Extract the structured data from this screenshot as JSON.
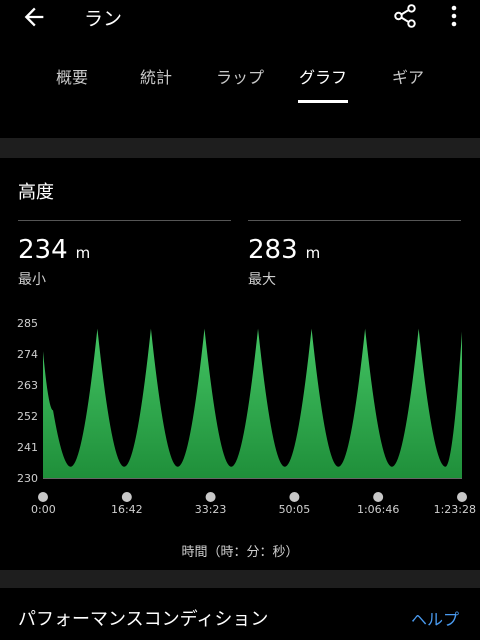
{
  "header": {
    "title": "ラン",
    "back_icon": "arrow-left-icon",
    "share_icon": "share-icon",
    "more_icon": "more-vert-icon"
  },
  "tabs": [
    {
      "label": "概要",
      "active": false
    },
    {
      "label": "統計",
      "active": false
    },
    {
      "label": "ラップ",
      "active": false
    },
    {
      "label": "グラフ",
      "active": true
    },
    {
      "label": "ギア",
      "active": false
    }
  ],
  "elevation": {
    "title": "高度",
    "min": {
      "value": "234",
      "unit": "m",
      "label": "最小"
    },
    "max": {
      "value": "283",
      "unit": "m",
      "label": "最大"
    }
  },
  "chart_data": {
    "type": "area",
    "ylim": [
      230,
      285
    ],
    "y_ticks": [
      "285",
      "274",
      "263",
      "252",
      "241",
      "230"
    ],
    "x_ticks": [
      "0:00",
      "16:42",
      "33:23",
      "50:05",
      "1:06:46",
      "1:23:28"
    ],
    "x_tick_seconds": [
      0,
      1002,
      2003,
      3005,
      4006,
      5008
    ],
    "xlabel": "時間（時：分：秒）",
    "x": [
      0,
      120,
      330,
      650,
      970,
      1290,
      1610,
      1930,
      2250,
      2570,
      2890,
      3210,
      3530,
      3850,
      4170,
      4490,
      4810,
      5008
    ],
    "y": [
      275,
      254,
      234,
      283,
      234,
      283,
      234,
      283,
      234,
      283,
      234,
      283,
      234,
      283,
      234,
      283,
      234,
      282
    ],
    "color": "#2ea84a"
  },
  "performance": {
    "title": "パフォーマンスコンディション",
    "help_label": "ヘルプ"
  }
}
